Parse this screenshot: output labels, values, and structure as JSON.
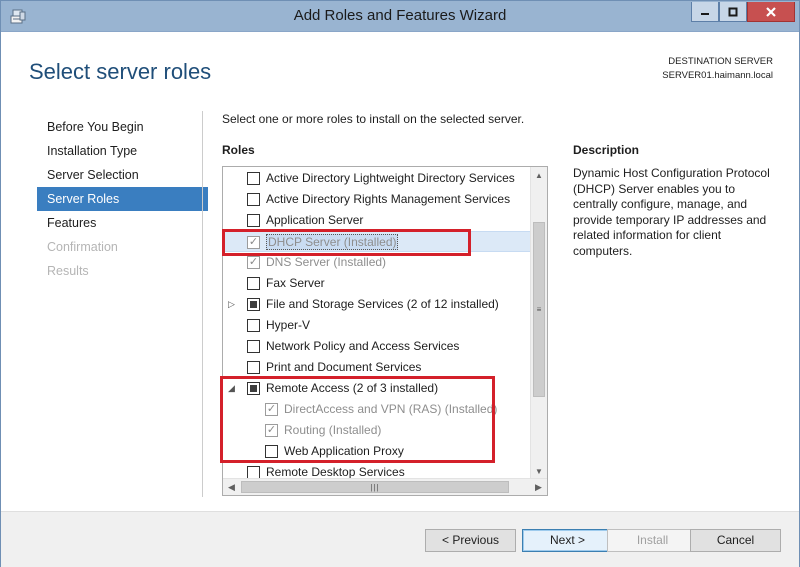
{
  "window": {
    "title": "Add Roles and Features Wizard",
    "app_icon": "server-manager-icon",
    "controls": {
      "minimize": "minimize-icon",
      "maximize": "maximize-icon",
      "close": "close-icon"
    }
  },
  "header": {
    "page_title": "Select server roles",
    "destination_label": "DESTINATION SERVER",
    "destination_server": "SERVER01.haimann.local"
  },
  "nav": {
    "items": [
      {
        "label": "Before You Begin",
        "state": "normal"
      },
      {
        "label": "Installation Type",
        "state": "normal"
      },
      {
        "label": "Server Selection",
        "state": "normal"
      },
      {
        "label": "Server Roles",
        "state": "active"
      },
      {
        "label": "Features",
        "state": "normal"
      },
      {
        "label": "Confirmation",
        "state": "disabled"
      },
      {
        "label": "Results",
        "state": "disabled"
      }
    ]
  },
  "main": {
    "instruction": "Select one or more roles to install on the selected server.",
    "roles_heading": "Roles",
    "roles": [
      {
        "label": "Active Directory Lightweight Directory Services",
        "check": "none",
        "disabled": false,
        "expander": "",
        "indent": 0
      },
      {
        "label": "Active Directory Rights Management Services",
        "check": "none",
        "disabled": false,
        "expander": "",
        "indent": 0
      },
      {
        "label": "Application Server",
        "check": "none",
        "disabled": false,
        "expander": "",
        "indent": 0
      },
      {
        "label": "DHCP Server (Installed)",
        "check": "checked",
        "disabled": true,
        "expander": "",
        "indent": 0,
        "selected": true
      },
      {
        "label": "DNS Server (Installed)",
        "check": "checked",
        "disabled": true,
        "expander": "",
        "indent": 0
      },
      {
        "label": "Fax Server",
        "check": "none",
        "disabled": false,
        "expander": "",
        "indent": 0
      },
      {
        "label": "File and Storage Services (2 of 12 installed)",
        "check": "partial",
        "disabled": false,
        "expander": "collapsed",
        "indent": 0
      },
      {
        "label": "Hyper-V",
        "check": "none",
        "disabled": false,
        "expander": "",
        "indent": 0
      },
      {
        "label": "Network Policy and Access Services",
        "check": "none",
        "disabled": false,
        "expander": "",
        "indent": 0
      },
      {
        "label": "Print and Document Services",
        "check": "none",
        "disabled": false,
        "expander": "",
        "indent": 0
      },
      {
        "label": "Remote Access (2 of 3 installed)",
        "check": "partial",
        "disabled": false,
        "expander": "expanded",
        "indent": 0
      },
      {
        "label": "DirectAccess and VPN (RAS) (Installed)",
        "check": "checked",
        "disabled": true,
        "expander": "",
        "indent": 1
      },
      {
        "label": "Routing (Installed)",
        "check": "checked",
        "disabled": true,
        "expander": "",
        "indent": 1
      },
      {
        "label": "Web Application Proxy",
        "check": "none",
        "disabled": false,
        "expander": "",
        "indent": 1
      },
      {
        "label": "Remote Desktop Services",
        "check": "none",
        "disabled": false,
        "expander": "",
        "indent": 0
      }
    ],
    "description_heading": "Description",
    "description_text": "Dynamic Host Configuration Protocol (DHCP) Server enables you to centrally configure, manage, and provide temporary IP addresses and related information for client computers."
  },
  "footer": {
    "previous": "< Previous",
    "next": "Next >",
    "install": "Install",
    "cancel": "Cancel"
  },
  "colors": {
    "title_bar": "#99b4d1",
    "nav_active": "#3a7ec0",
    "page_title": "#1f4e79",
    "highlight_box": "#d4202a"
  }
}
